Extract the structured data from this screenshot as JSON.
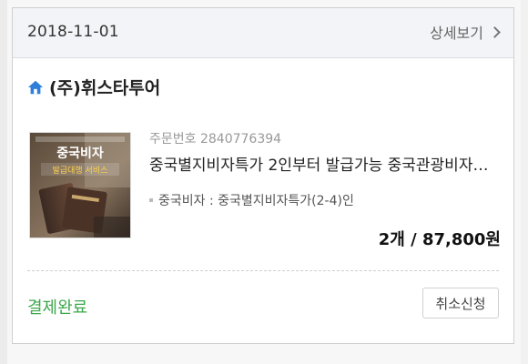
{
  "order": {
    "date": "2018-11-01",
    "detail_link": "상세보기",
    "shop_name": "(주)휘스타투어",
    "order_number_text": "주문번호 2840776394",
    "product_title": "중국별지비자특가 2인부터 발급가능 중국관광비자…",
    "option_text": "중국비자 : 중국별지비자특가(2-4)인",
    "price_text": "2개 / 87,800원",
    "status": "결제완료",
    "cancel_label": "취소신청"
  },
  "thumbnail": {
    "line1": "중국비자",
    "line2": "발급대행 서비스"
  },
  "colors": {
    "status_green": "#3aa84a",
    "home_icon_blue": "#2f7fd9",
    "header_bg": "#f3f4f7"
  },
  "icons": {
    "shop": "home-icon",
    "detail": "chevron-right-icon",
    "option": "bullet-square-icon"
  }
}
